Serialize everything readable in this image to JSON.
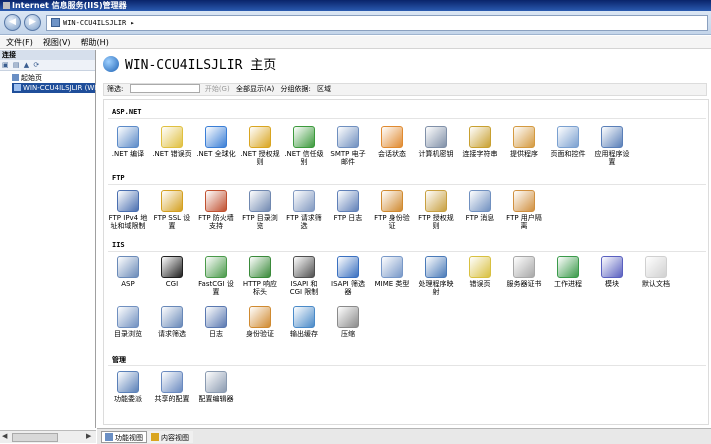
{
  "window": {
    "title": "Internet 信息服务(IIS)管理器"
  },
  "address": {
    "path": "WIN-CCU4ILSJLIR  ▸",
    "back": "◀",
    "forward": "▶"
  },
  "menu": [
    "文件(F)",
    "视图(V)",
    "帮助(H)"
  ],
  "left": {
    "header": "连接",
    "tree": [
      {
        "label": "起始页"
      },
      {
        "label": "WIN-CCU4ILSJLIR (WI"
      }
    ],
    "scroll_left": "◀",
    "scroll_right": "▶"
  },
  "main": {
    "title": "WIN-CCU4ILSJLIR 主页",
    "filter": {
      "label": "筛选:",
      "start": "开始(G)",
      "show_all": "全部显示(A)",
      "group_by": "分组依据:",
      "group_value": "区域"
    }
  },
  "sections": [
    {
      "name": "ASP.NET",
      "items": [
        {
          "label": ".NET 编译",
          "icon": "dotnet-compile-icon",
          "color": "#5b8ac8"
        },
        {
          "label": ".NET 错误页",
          "icon": "error-page-icon",
          "color": "#e0c040"
        },
        {
          "label": ".NET 全球化",
          "icon": "globe-icon",
          "color": "#3a7ed6"
        },
        {
          "label": ".NET 授权规则",
          "icon": "lock-icon",
          "color": "#d9a520"
        },
        {
          "label": ".NET 信任级别",
          "icon": "trust-icon",
          "color": "#3c9a3c"
        },
        {
          "label": "SMTP 电子邮件",
          "icon": "mail-icon",
          "color": "#6f8fbf"
        },
        {
          "label": "会话状态",
          "icon": "session-icon",
          "color": "#e08a30"
        },
        {
          "label": "计算机密钥",
          "icon": "machine-key-icon",
          "color": "#8090a8"
        },
        {
          "label": "连接字符串",
          "icon": "connection-string-icon",
          "color": "#c8a030"
        },
        {
          "label": "提供程序",
          "icon": "provider-icon",
          "color": "#d49a40"
        },
        {
          "label": "页面和控件",
          "icon": "pages-controls-icon",
          "color": "#7aa0d0"
        },
        {
          "label": "应用程序设置",
          "icon": "app-settings-icon",
          "color": "#5a7fb8"
        }
      ]
    },
    {
      "name": "FTP",
      "items": [
        {
          "label": "FTP IPv4 地址和域限制",
          "icon": "ftp-ip-icon",
          "color": "#4a6fb0"
        },
        {
          "label": "FTP SSL 设置",
          "icon": "ftp-ssl-icon",
          "color": "#d4a020"
        },
        {
          "label": "FTP 防火墙支持",
          "icon": "ftp-firewall-icon",
          "color": "#c05030"
        },
        {
          "label": "FTP 目录浏览",
          "icon": "ftp-dir-icon",
          "color": "#7088b0"
        },
        {
          "label": "FTP 请求筛选",
          "icon": "ftp-filter-icon",
          "color": "#8098c0"
        },
        {
          "label": "FTP 日志",
          "icon": "ftp-log-icon",
          "color": "#6080b8"
        },
        {
          "label": "FTP 身份验证",
          "icon": "ftp-auth-icon",
          "color": "#d08a30"
        },
        {
          "label": "FTP 授权规则",
          "icon": "ftp-authz-icon",
          "color": "#c8a040"
        },
        {
          "label": "FTP 消息",
          "icon": "ftp-message-icon",
          "color": "#7090c0"
        },
        {
          "label": "FTP 用户隔离",
          "icon": "ftp-isolation-icon",
          "color": "#d09040"
        }
      ]
    },
    {
      "name": "IIS",
      "items": [
        {
          "label": "ASP",
          "icon": "asp-icon",
          "color": "#6a8ab8"
        },
        {
          "label": "CGI",
          "icon": "cgi-icon",
          "color": "#202020"
        },
        {
          "label": "FastCGI 设置",
          "icon": "fastcgi-icon",
          "color": "#4a9a4a"
        },
        {
          "label": "HTTP 响应标头",
          "icon": "http-headers-icon",
          "color": "#3a8a3a"
        },
        {
          "label": "ISAPI 和 CGI 限制",
          "icon": "isapi-cgi-icon",
          "color": "#505050"
        },
        {
          "label": "ISAPI 筛选器",
          "icon": "isapi-filter-icon",
          "color": "#3a70c0"
        },
        {
          "label": "MIME 类型",
          "icon": "mime-icon",
          "color": "#7898c8"
        },
        {
          "label": "处理程序映射",
          "icon": "handler-mapping-icon",
          "color": "#4a7ab8"
        },
        {
          "label": "错误页",
          "icon": "error-pages-icon",
          "color": "#d8c040"
        },
        {
          "label": "服务器证书",
          "icon": "certificate-icon",
          "color": "#a8a8a8"
        },
        {
          "label": "工作进程",
          "icon": "worker-process-icon",
          "color": "#3a9a4a"
        },
        {
          "label": "模块",
          "icon": "modules-icon",
          "color": "#5a60c0"
        },
        {
          "label": "默认文档",
          "icon": "default-document-icon",
          "color": "#d0d0d0"
        },
        {
          "label": "目录浏览",
          "icon": "directory-browsing-icon",
          "color": "#7090c0"
        },
        {
          "label": "请求筛选",
          "icon": "request-filtering-icon",
          "color": "#6888b8"
        },
        {
          "label": "日志",
          "icon": "logging-icon",
          "color": "#5a78b0"
        },
        {
          "label": "身份验证",
          "icon": "authentication-icon",
          "color": "#d08a30"
        },
        {
          "label": "输出缓存",
          "icon": "output-cache-icon",
          "color": "#4a8ac8"
        },
        {
          "label": "压缩",
          "icon": "compression-icon",
          "color": "#8a8a8a"
        }
      ]
    },
    {
      "name": "管理",
      "items": [
        {
          "label": "功能委派",
          "icon": "feature-delegation-icon",
          "color": "#5a80b8"
        },
        {
          "label": "共享的配置",
          "icon": "shared-config-icon",
          "color": "#6a8ac0"
        },
        {
          "label": "配置编辑器",
          "icon": "config-editor-icon",
          "color": "#8a9ab0"
        }
      ]
    }
  ],
  "bottom": {
    "features_view": "功能视图",
    "content_view": "内容视图"
  }
}
